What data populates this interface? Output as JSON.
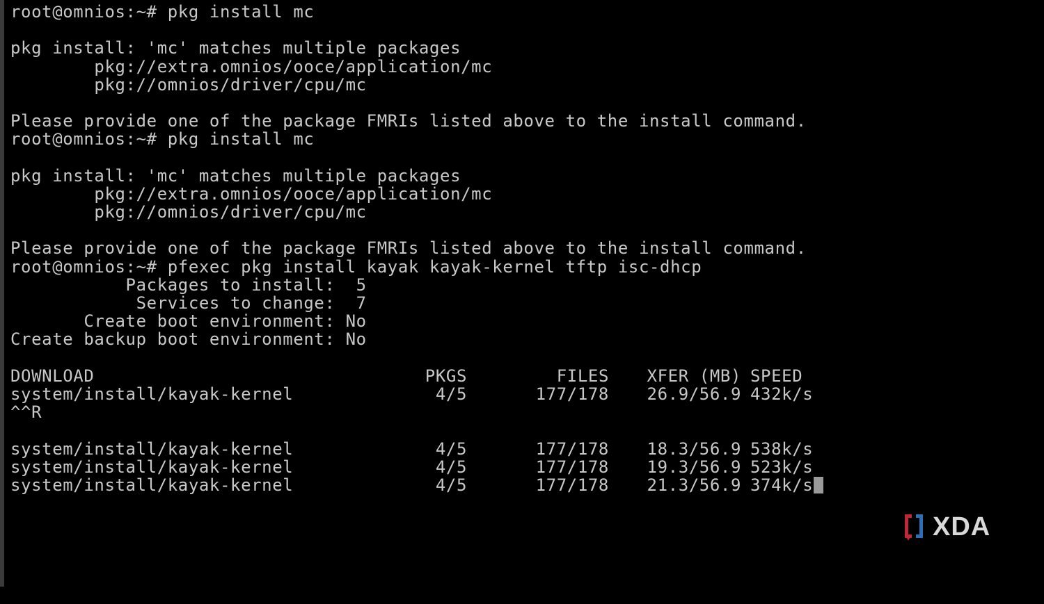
{
  "terminal": {
    "lines": [
      "root@omnios:~# pkg install mc",
      "",
      "pkg install: 'mc' matches multiple packages",
      "        pkg://extra.omnios/ooce/application/mc",
      "        pkg://omnios/driver/cpu/mc",
      "",
      "Please provide one of the package FMRIs listed above to the install command.",
      "root@omnios:~# pkg install mc",
      "",
      "pkg install: 'mc' matches multiple packages",
      "        pkg://extra.omnios/ooce/application/mc",
      "        pkg://omnios/driver/cpu/mc",
      "",
      "Please provide one of the package FMRIs listed above to the install command.",
      "root@omnios:~# pfexec pkg install kayak kayak-kernel tftp isc-dhcp",
      "           Packages to install:  5",
      "            Services to change:  7",
      "       Create boot environment: No",
      "Create backup boot environment: No",
      ""
    ],
    "download_header": {
      "name": "DOWNLOAD",
      "pkgs": "PKGS",
      "files": "FILES",
      "xfer": "XFER (MB)",
      "speed": "SPEED"
    },
    "download_rows_before": [
      {
        "name": "system/install/kayak-kernel",
        "pkgs": "4/5",
        "files": "177/178",
        "xfer": "26.9/56.9",
        "speed": "432k/s"
      }
    ],
    "interrupt_line": "^^R",
    "download_rows_after": [
      {
        "name": "system/install/kayak-kernel",
        "pkgs": "4/5",
        "files": "177/178",
        "xfer": "18.3/56.9",
        "speed": "538k/s"
      },
      {
        "name": "system/install/kayak-kernel",
        "pkgs": "4/5",
        "files": "177/178",
        "xfer": "19.3/56.9",
        "speed": "523k/s"
      },
      {
        "name": "system/install/kayak-kernel",
        "pkgs": "4/5",
        "files": "177/178",
        "xfer": "21.3/56.9",
        "speed": "374k/s"
      }
    ]
  },
  "watermark": {
    "text": "XDA",
    "bracket_color": "#c0283a",
    "accent_color": "#2d6fb5",
    "text_color": "#d8d8d8"
  }
}
